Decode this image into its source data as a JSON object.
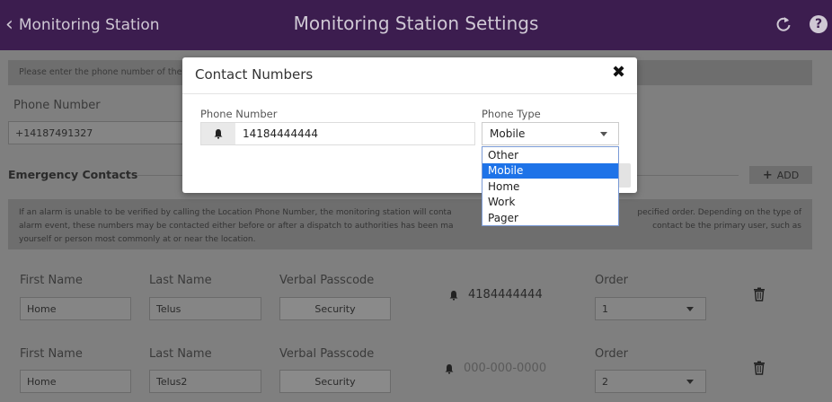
{
  "header": {
    "back_label": "Monitoring Station",
    "title": "Monitoring Station Settings"
  },
  "page": {
    "info_text": "Please enter the phone number of the",
    "phone_number_label": "Phone Number",
    "phone_number_value": "+14187491327",
    "emergency_title": "Emergency Contacts",
    "add_label": "ADD",
    "description": [
      "If an alarm is unable to be verified by calling the Location Phone Number, the monitoring station will conta",
      "pecified order. Depending on the type of",
      "alarm event, these numbers may be contacted either before or after a dispatch to authorities has been ma",
      "contact be the primary user, such as",
      "yourself or person most commonly at or near the location."
    ],
    "contacts": [
      {
        "first_label": "First Name",
        "first_value": "Home",
        "last_label": "Last Name",
        "last_value": "Telus",
        "passcode_label": "Verbal Passcode",
        "passcode_value": "Security",
        "phone": "4184444444",
        "order_label": "Order",
        "order_value": "1"
      },
      {
        "first_label": "First Name",
        "first_value": "Home",
        "last_label": "Last Name",
        "last_value": "Telus2",
        "passcode_label": "Verbal Passcode",
        "passcode_value": "Security",
        "phone_placeholder": "000-000-0000",
        "order_label": "Order",
        "order_value": "2"
      }
    ]
  },
  "modal": {
    "title": "Contact Numbers",
    "close_glyph": "✖",
    "phone_label": "Phone Number",
    "phone_value": "14184444444",
    "type_label": "Phone Type",
    "type_value": "Mobile",
    "options": [
      "Other",
      "Mobile",
      "Home",
      "Work",
      "Pager"
    ]
  },
  "colors": {
    "header_bg": "#3c1d4f",
    "selected_option": "#1e73e8"
  }
}
